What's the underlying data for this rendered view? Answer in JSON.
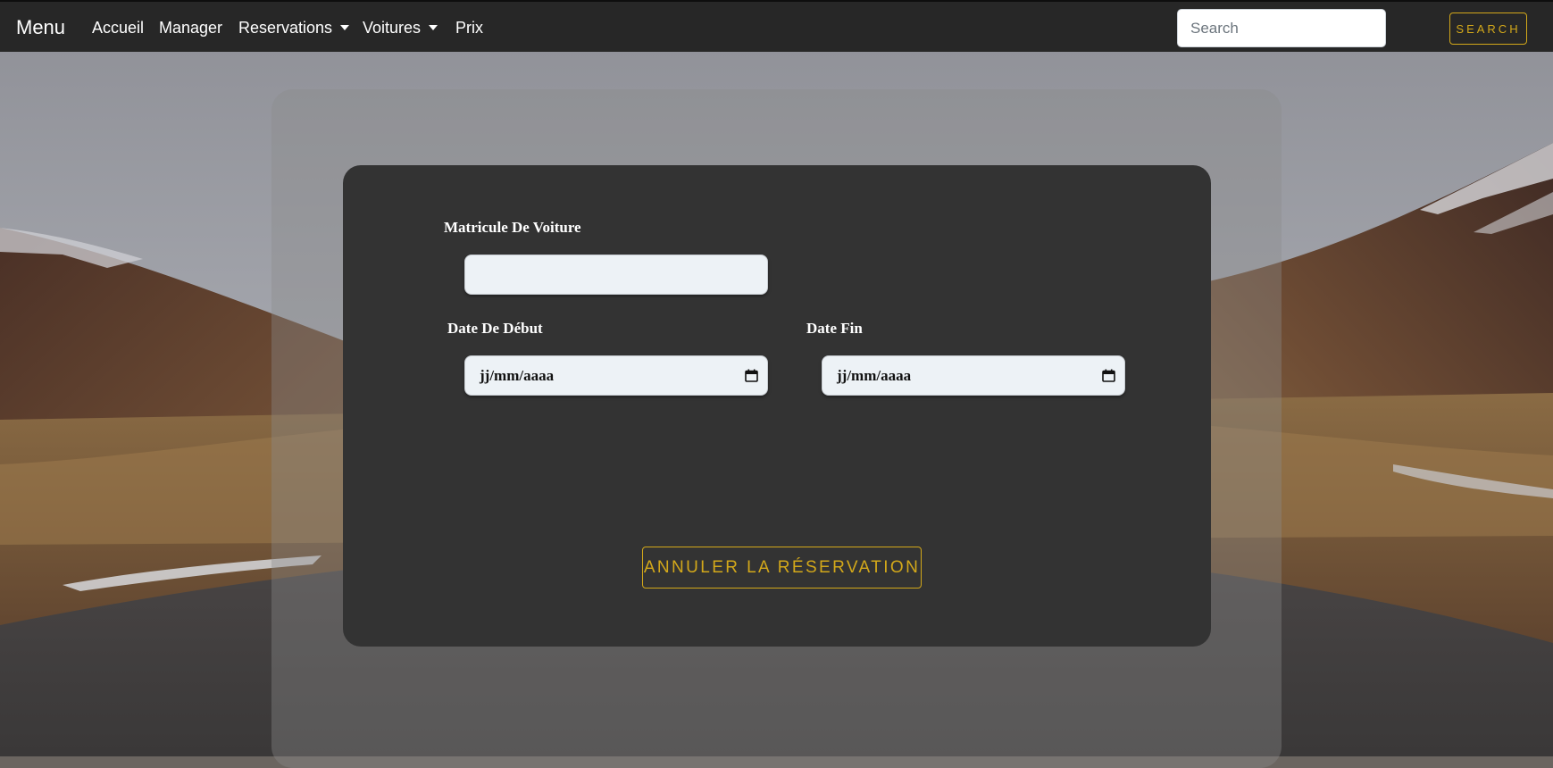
{
  "navbar": {
    "brand": "Menu",
    "items": [
      {
        "label": "Accueil"
      },
      {
        "label": "Manager"
      },
      {
        "label": "Reservations"
      },
      {
        "label": "Voitures"
      },
      {
        "label": "Prix"
      }
    ],
    "search_placeholder": "Search",
    "search_value": "",
    "search_button": "SEARCH"
  },
  "form": {
    "matricule_label": "Matricule De Voiture",
    "matricule_value": "",
    "date_debut_label": "Date De Début",
    "date_debut_placeholder": "jj/mm/aaaa",
    "date_fin_label": "Date Fin",
    "date_fin_placeholder": "jj/mm/aaaa",
    "cancel_button": "ANNULER LA RÉSERVATION"
  },
  "colors": {
    "navbar_bg": "#272727",
    "accent_gold": "#d3a81a",
    "form_card_bg": "#333333",
    "input_bg": "#edf2f6"
  },
  "icons": [
    "calendar-icon",
    "chevron-down-icon"
  ]
}
